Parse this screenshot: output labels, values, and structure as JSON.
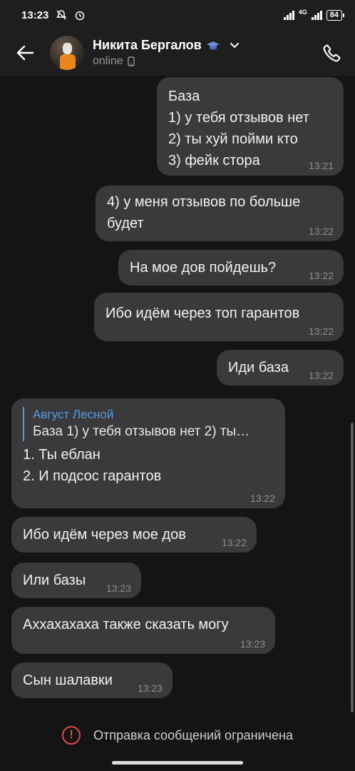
{
  "status_bar": {
    "time": "13:23",
    "network": "4G",
    "battery": "84"
  },
  "header": {
    "contact_name": "Никита Бергалов",
    "status": "online"
  },
  "messages": [
    {
      "side": "out",
      "text": "База\n1) у тебя отзывов нет\n2) ты хуй пойми кто\n3) фейк стора",
      "time": "13:21"
    },
    {
      "side": "out",
      "text": "4) у меня отзывов по больше\nбудет",
      "time": "13:22"
    },
    {
      "side": "out",
      "text": "На мое дов пойдешь?",
      "time": "13:22"
    },
    {
      "side": "out",
      "text": "Ибо идём через топ гарантов",
      "time": "13:22"
    },
    {
      "side": "out",
      "text": "Иди база",
      "time": "13:22"
    },
    {
      "side": "in",
      "reply_author": "Август Лесной",
      "reply_text": "База 1) у тебя отзывов нет 2) ты…",
      "text": "1. Ты еблан\n2. И подсос гарантов",
      "time": "13:22"
    },
    {
      "side": "in",
      "text": "Ибо идём через мое дов",
      "time": "13:22"
    },
    {
      "side": "in",
      "text": "Или базы",
      "time": "13:23"
    },
    {
      "side": "in",
      "text": "Аххахахаха также сказать могу",
      "time": "13:23"
    },
    {
      "side": "in",
      "text": "Сын шалавки",
      "time": "13:23"
    }
  ],
  "footer": {
    "notice": "Отправка сообщений ограничена"
  }
}
